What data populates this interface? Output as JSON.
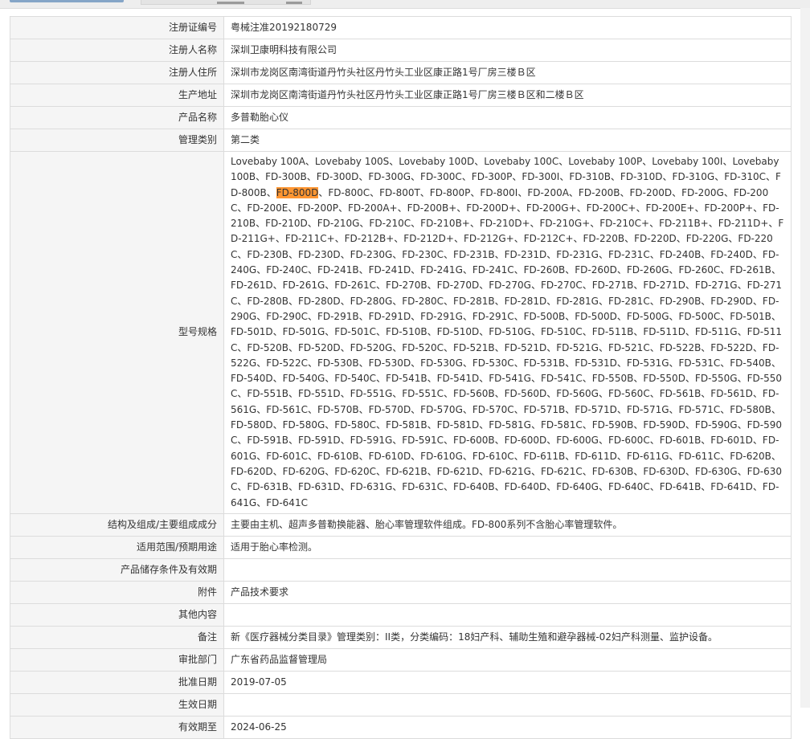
{
  "colors": {
    "label_bg": "#f5f5f5",
    "border": "#dcdcdc",
    "highlight": "#ff9632",
    "text": "#333333"
  },
  "fields": {
    "reg_no": {
      "label": "注册证编号",
      "value": "粤械注准20192180729"
    },
    "registrant": {
      "label": "注册人名称",
      "value": "深圳卫康明科技有限公司"
    },
    "address": {
      "label": "注册人住所",
      "value": "深圳市龙岗区南湾街道丹竹头社区丹竹头工业区康正路1号厂房三楼Ｂ区"
    },
    "prod_addr": {
      "label": "生产地址",
      "value": "深圳市龙岗区南湾街道丹竹头社区丹竹头工业区康正路1号厂房三楼Ｂ区和二楼Ｂ区"
    },
    "product": {
      "label": "产品名称",
      "value": "多普勒胎心仪"
    },
    "category": {
      "label": "管理类别",
      "value": "第二类"
    },
    "models": {
      "label": "型号规格",
      "before": "Lovebaby 100A、Lovebaby 100S、Lovebaby 100D、Lovebaby 100C、Lovebaby 100P、Lovebaby 100I、Lovebaby 100B、FD-300B、FD-300D、FD-300G、FD-300C、FD-300P、FD-300I、FD-310B、FD-310D、FD-310G、FD-310C、FD-800B、",
      "highlight": "FD-800D",
      "after": "、FD-800C、FD-800T、FD-800P、FD-800I、FD-200A、FD-200B、FD-200D、FD-200G、FD-200C、FD-200E、FD-200P、FD-200A+、FD-200B+、FD-200D+、FD-200G+、FD-200C+、FD-200E+、FD-200P+、FD-210B、FD-210D、FD-210G、FD-210C、FD-210B+、FD-210D+、FD-210G+、FD-210C+、FD-211B+、FD-211D+、FD-211G+、FD-211C+、FD-212B+、FD-212D+、FD-212G+、FD-212C+、FD-220B、FD-220D、FD-220G、FD-220C、FD-230B、FD-230D、FD-230G、FD-230C、FD-231B、FD-231D、FD-231G、FD-231C、FD-240B、FD-240D、FD-240G、FD-240C、FD-241B、FD-241D、FD-241G、FD-241C、FD-260B、FD-260D、FD-260G、FD-260C、FD-261B、FD-261D、FD-261G、FD-261C、FD-270B、FD-270D、FD-270G、FD-270C、FD-271B、FD-271D、FD-271G、FD-271C、FD-280B、FD-280D、FD-280G、FD-280C、FD-281B、FD-281D、FD-281G、FD-281C、FD-290B、FD-290D、FD-290G、FD-290C、FD-291B、FD-291D、FD-291G、FD-291C、FD-500B、FD-500D、FD-500G、FD-500C、FD-501B、FD-501D、FD-501G、FD-501C、FD-510B、FD-510D、FD-510G、FD-510C、FD-511B、FD-511D、FD-511G、FD-511C、FD-520B、FD-520D、FD-520G、FD-520C、FD-521B、FD-521D、FD-521G、FD-521C、FD-522B、FD-522D、FD-522G、FD-522C、FD-530B、FD-530D、FD-530G、FD-530C、FD-531B、FD-531D、FD-531G、FD-531C、FD-540B、FD-540D、FD-540G、FD-540C、FD-541B、FD-541D、FD-541G、FD-541C、FD-550B、FD-550D、FD-550G、FD-550C、FD-551B、FD-551D、FD-551G、FD-551C、FD-560B、FD-560D、FD-560G、FD-560C、FD-561B、FD-561D、FD-561G、FD-561C、FD-570B、FD-570D、FD-570G、FD-570C、FD-571B、FD-571D、FD-571G、FD-571C、FD-580B、FD-580D、FD-580G、FD-580C、FD-581B、FD-581D、FD-581G、FD-581C、FD-590B、FD-590D、FD-590G、FD-590C、FD-591B、FD-591D、FD-591G、FD-591C、FD-600B、FD-600D、FD-600G、FD-600C、FD-601B、FD-601D、FD-601G、FD-601C、FD-610B、FD-610D、FD-610G、FD-610C、FD-611B、FD-611D、FD-611G、FD-611C、FD-620B、FD-620D、FD-620G、FD-620C、FD-621B、FD-621D、FD-621G、FD-621C、FD-630B、FD-630D、FD-630G、FD-630C、FD-631B、FD-631D、FD-631G、FD-631C、FD-640B、FD-640D、FD-640G、FD-640C、FD-641B、FD-641D、FD-641G、FD-641C"
    },
    "structure": {
      "label": "结构及组成/主要组成成分",
      "value": "主要由主机、超声多普勒换能器、胎心率管理软件组成。FD-800系列不含胎心率管理软件。"
    },
    "scope": {
      "label": "适用范围/预期用途",
      "value": "适用于胎心率检测。"
    },
    "storage": {
      "label": "产品储存条件及有效期",
      "value": ""
    },
    "attachment": {
      "label": "附件",
      "value": "产品技术要求"
    },
    "other": {
      "label": "其他内容",
      "value": ""
    },
    "remark": {
      "label": "备注",
      "value": "新《医疗器械分类目录》管理类别：II类，分类编码：18妇产科、辅助生殖和避孕器械-02妇产科测量、监护设备。"
    },
    "dept": {
      "label": "审批部门",
      "value": "广东省药品监督管理局"
    },
    "approve": {
      "label": "批准日期",
      "value": "2019-07-05"
    },
    "effective": {
      "label": "生效日期",
      "value": ""
    },
    "expire": {
      "label": "有效期至",
      "value": "2024-06-25"
    }
  }
}
